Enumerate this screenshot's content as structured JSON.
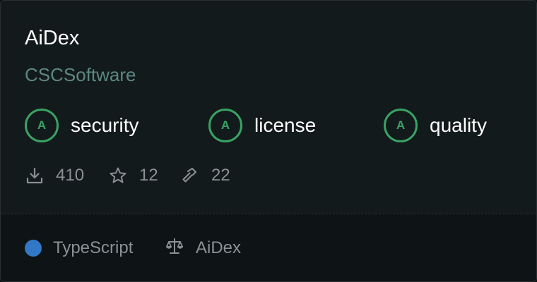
{
  "package": {
    "name": "AiDex",
    "owner": "CSCSoftware"
  },
  "scores": [
    {
      "grade": "A",
      "label": "security"
    },
    {
      "grade": "A",
      "label": "license"
    },
    {
      "grade": "A",
      "label": "quality"
    }
  ],
  "stats": {
    "downloads": "410",
    "stars": "12",
    "builds": "22"
  },
  "footer": {
    "language": "TypeScript",
    "license": "AiDex"
  },
  "colors": {
    "grade_a": "#3aa264",
    "typescript": "#3178c6",
    "owner_text": "#5e8782",
    "muted_text": "#8a9094"
  },
  "icons": {
    "downloads": "download-icon",
    "stars": "star-icon",
    "builds": "hammer-icon",
    "license": "scale-icon"
  }
}
